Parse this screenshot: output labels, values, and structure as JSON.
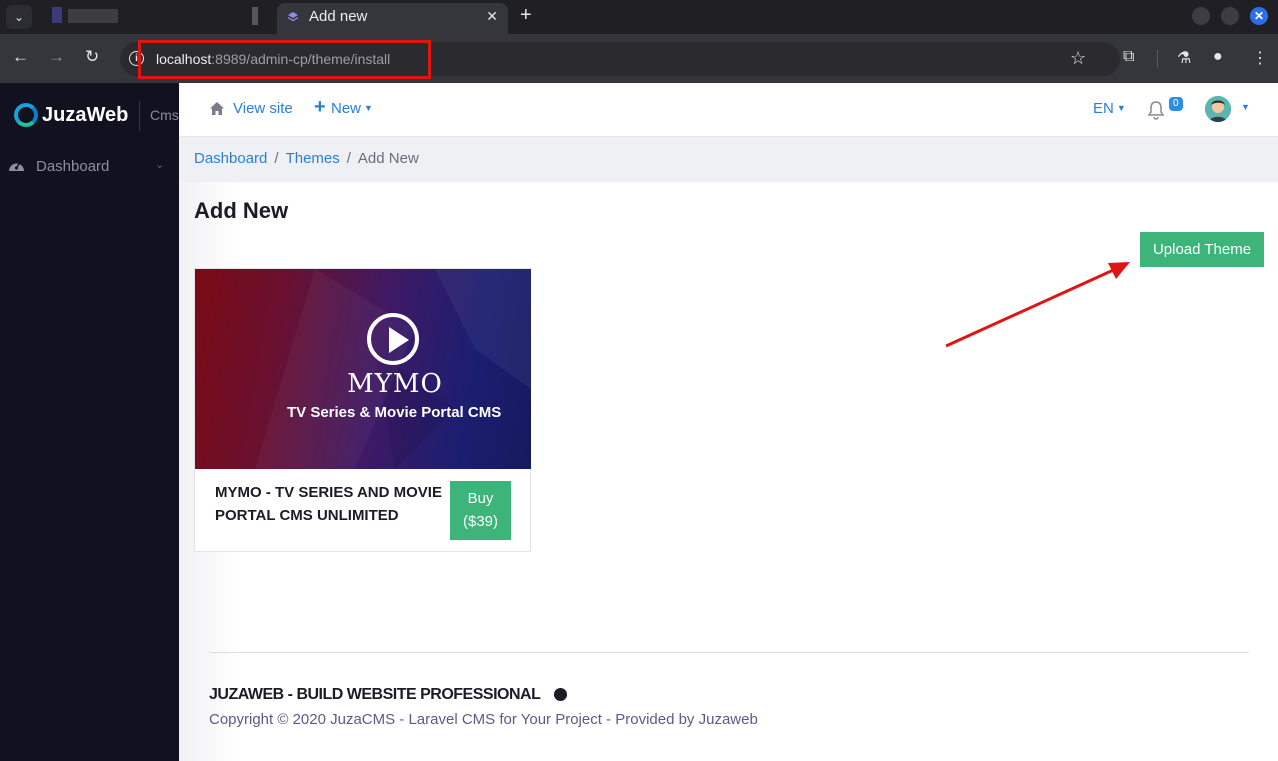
{
  "browser": {
    "tab_title": "Add new",
    "tab_close": "✕",
    "new_tab": "+",
    "url_host": "localhost",
    "url_path": ":8989/admin-cp/theme/install"
  },
  "sidebar": {
    "brand": "JuzaWeb",
    "brand_suffix": "Cms",
    "items": [
      {
        "label": "Dashboard"
      }
    ]
  },
  "topnav": {
    "view_site": "View site",
    "new": "New",
    "language": "EN",
    "notification_count": "0"
  },
  "breadcrumb": {
    "items": [
      "Dashboard",
      "Themes"
    ],
    "current": "Add New"
  },
  "page": {
    "title": "Add New",
    "upload_button": "Upload Theme"
  },
  "themes": [
    {
      "thumb_title": "MYMO",
      "thumb_subtitle": "TV Series & Movie Portal CMS",
      "name": "MYMO - TV SERIES AND MOVIE PORTAL CMS UNLIMITED",
      "buy_label": "Buy",
      "price": "($39)"
    }
  ],
  "footer": {
    "brand": "JUZAWEB - BUILD WEBSITE PROFESSIONAL",
    "copyright": "Copyright © 2020 JuzaCMS - Laravel CMS for Your Project - Provided by Juzaweb"
  },
  "colors": {
    "accent_blue": "#2a7fd6",
    "button_green": "#3cb47a",
    "sidebar_bg": "#12111f",
    "annotation_red": "#e11414"
  }
}
